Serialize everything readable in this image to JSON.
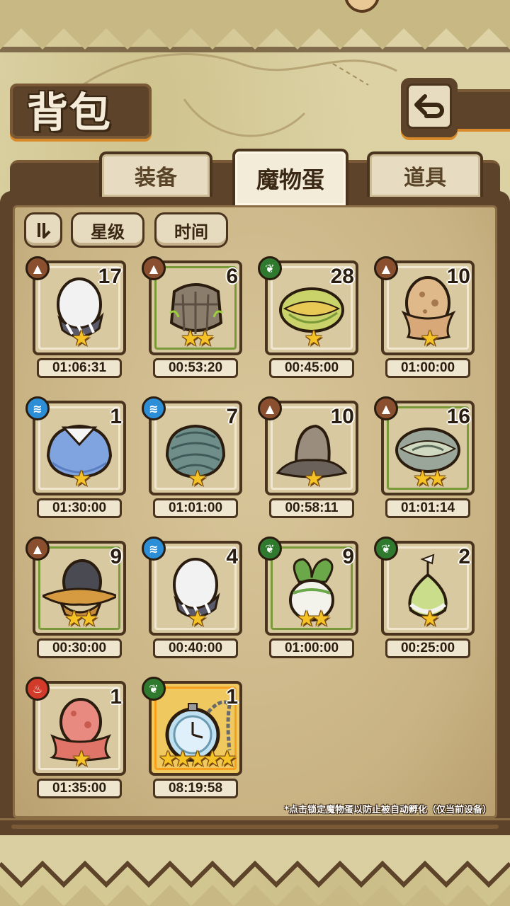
{
  "header": {
    "title": "背包",
    "back_icon": "return-arrow-icon"
  },
  "tabs": [
    {
      "label": "装备",
      "active": false
    },
    {
      "label": "魔物蛋",
      "active": true
    },
    {
      "label": "道具",
      "active": false
    }
  ],
  "sort": {
    "toggle_icon": "sort-order-icon",
    "star_label": "星级",
    "time_label": "时间"
  },
  "eggs": [
    {
      "element": "earth",
      "count": "17",
      "stars": 1,
      "time": "01:06:31",
      "frame": "plain",
      "art": "white-striped-egg"
    },
    {
      "element": "earth",
      "count": "6",
      "stars": 2,
      "time": "00:53:20",
      "frame": "green",
      "art": "stone-egg"
    },
    {
      "element": "grass",
      "count": "28",
      "stars": 1,
      "time": "00:45:00",
      "frame": "plain",
      "art": "leaf-egg"
    },
    {
      "element": "earth",
      "count": "10",
      "stars": 1,
      "time": "01:00:00",
      "frame": "plain",
      "art": "sand-egg"
    },
    {
      "element": "water",
      "count": "1",
      "stars": 1,
      "time": "01:30:00",
      "frame": "plain",
      "art": "blue-feather-egg"
    },
    {
      "element": "water",
      "count": "7",
      "stars": 1,
      "time": "01:01:00",
      "frame": "plain",
      "art": "shell-egg"
    },
    {
      "element": "earth",
      "count": "10",
      "stars": 1,
      "time": "00:58:11",
      "frame": "plain",
      "art": "rock-egg"
    },
    {
      "element": "earth",
      "count": "16",
      "stars": 2,
      "time": "01:01:14",
      "frame": "green",
      "art": "grey-leaf-egg"
    },
    {
      "element": "earth",
      "count": "9",
      "stars": 2,
      "time": "00:30:00",
      "frame": "green",
      "art": "hat-egg"
    },
    {
      "element": "water",
      "count": "4",
      "stars": 1,
      "time": "00:40:00",
      "frame": "plain",
      "art": "white-striped-egg-2"
    },
    {
      "element": "grass",
      "count": "9",
      "stars": 2,
      "time": "01:00:00",
      "frame": "green",
      "art": "turnip-egg"
    },
    {
      "element": "grass",
      "count": "2",
      "stars": 1,
      "time": "00:25:00",
      "frame": "plain",
      "art": "bulb-egg"
    },
    {
      "element": "fire",
      "count": "1",
      "stars": 1,
      "time": "01:35:00",
      "frame": "plain",
      "art": "pink-slime-egg"
    },
    {
      "element": "grass",
      "count": "1",
      "stars": 5,
      "time": "08:19:58",
      "frame": "gold",
      "art": "pocket-watch-egg"
    }
  ],
  "footer_note": "*点击锁定魔物蛋以防止被自动孵化（仅当前设备）",
  "colors": {
    "frame_brown": "#5c432a",
    "accent_orange": "#d98a2b",
    "star_yellow": "#f5c325",
    "earth": "#8a4f2e",
    "grass": "#2f7a2f",
    "water": "#2c8ed6",
    "fire": "#d23a2a"
  }
}
